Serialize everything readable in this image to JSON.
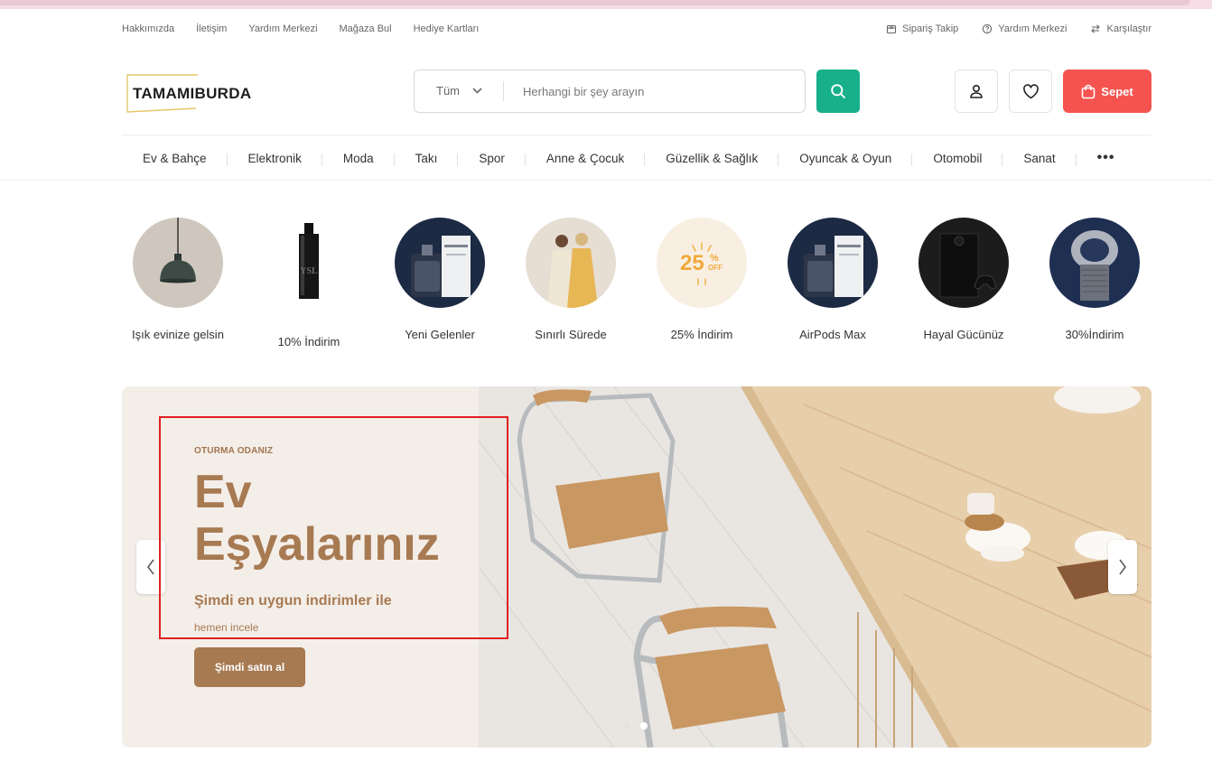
{
  "topbar": {
    "links": [
      "Hakkımızda",
      "İletişim",
      "Yardım Merkezi",
      "Mağaza Bul",
      "Hediye Kartları"
    ],
    "right_links": [
      {
        "icon": "package-icon",
        "label": "Sipariş Takip"
      },
      {
        "icon": "help-circle-icon",
        "label": "Yardım Merkezi"
      },
      {
        "icon": "compare-arrows-icon",
        "label": "Karşılaştır"
      }
    ]
  },
  "brand": {
    "name": "TAMAMIBURDA"
  },
  "search": {
    "category": "Tüm",
    "placeholder": "Herhangi bir şey arayın"
  },
  "header": {
    "cart_label": "Sepet"
  },
  "categories": [
    "Ev & Bahçe",
    "Elektronik",
    "Moda",
    "Takı",
    "Spor",
    "Anne & Çocuk",
    "Güzellik & Sağlık",
    "Oyuncak & Oyun",
    "Otomobil",
    "Sanat"
  ],
  "featured": [
    {
      "label": "Işık evinize gelsin",
      "image": "pendant-lamp"
    },
    {
      "label": "10% İndirim",
      "image": "perfume-bottle"
    },
    {
      "label": "Yeni Gelenler",
      "image": "phantom-perfume"
    },
    {
      "label": "Sınırlı Sürede",
      "image": "two-women-fashion"
    },
    {
      "label": "25% İndirim",
      "image": "discount-badge"
    },
    {
      "label": "AirPods Max",
      "image": "phantom-perfume"
    },
    {
      "label": "Hayal Gücünüz",
      "image": "game-console"
    },
    {
      "label": "30%İndirim",
      "image": "air-purifier"
    }
  ],
  "badge": {
    "percent": "25",
    "sign": "%",
    "off": "OFF"
  },
  "hero": {
    "eyebrow": "OTURMA ODANIZ",
    "title_line1": "Ev",
    "title_line2": "Eşyalarınız",
    "subtitle": "Şimdi en uygun indirimler ile",
    "subtext": "hemen incele",
    "cta": "Şimdi satın al",
    "slides": 2,
    "active_slide": 2
  },
  "colors": {
    "accent_green": "#17b08a",
    "cart_red": "#f5534f",
    "hero_brown": "#a77a52",
    "hero_bg": "#f4eee9",
    "highlight": "#e02020"
  }
}
